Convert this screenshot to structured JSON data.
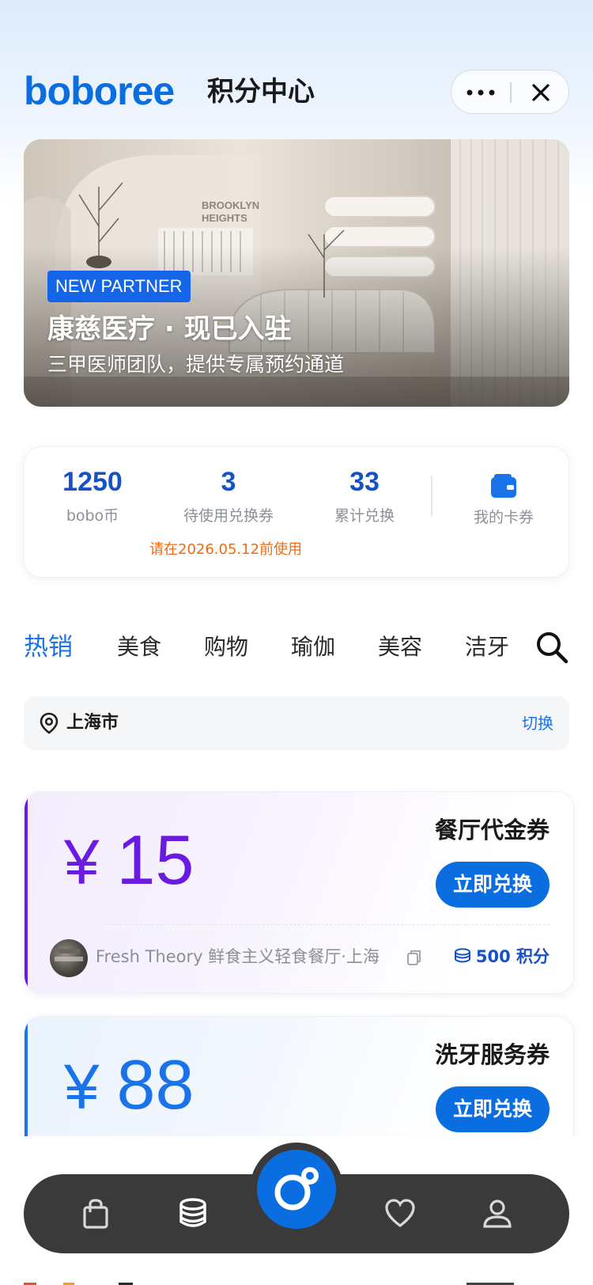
{
  "header": {
    "logo": "boboree",
    "title": "积分中心",
    "more_icon": "more-dots-icon",
    "close_icon": "close-icon"
  },
  "banner": {
    "badge": "NEW PARTNER",
    "title": "康慈医疗 · 现已入驻",
    "subtitle": "三甲医师团队，提供专属预约通道",
    "sign_text": "BROOKLYN HEIGHTS"
  },
  "stats": {
    "items": [
      {
        "value": "1250",
        "label": "bobo币"
      },
      {
        "value": "3",
        "label": "待使用兑换券"
      },
      {
        "value": "33",
        "label": "累计兑换"
      }
    ],
    "wallet": {
      "label": "我的卡券",
      "icon": "wallet-icon"
    },
    "note": "请在2026.05.12前使用"
  },
  "tabs": {
    "items": [
      "热销",
      "美食",
      "购物",
      "瑜伽",
      "美容",
      "洁牙"
    ],
    "active": "热销",
    "search_icon": "search-icon"
  },
  "location": {
    "city": "上海市",
    "switch_label": "切换"
  },
  "coupons": [
    {
      "yen": "¥",
      "amount": "15",
      "title": "餐厅代金券",
      "button": "立即兑换",
      "merchant": "Fresh Theory 鲜食主义轻食餐厅·上海",
      "points": "500 积分",
      "accent": "#6a1be0"
    },
    {
      "yen": "¥",
      "amount": "88",
      "title": "洗牙服务券",
      "button": "立即兑换",
      "accent": "#1a73e8"
    }
  ],
  "nav": {
    "items": [
      "bag-icon",
      "coins-icon",
      "brand-center-icon",
      "heart-icon",
      "profile-icon"
    ]
  },
  "colors": {
    "brand_blue": "#0a6ee0",
    "stat_blue": "#1652c6",
    "purple": "#6a1be0",
    "warning_orange": "#f06a0f",
    "nav_dark": "#3a3a3a"
  }
}
